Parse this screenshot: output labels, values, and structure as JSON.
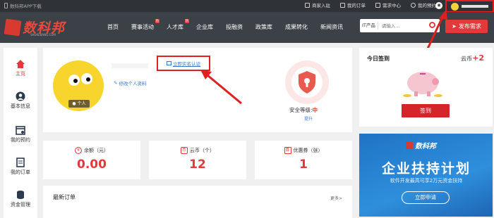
{
  "topbar": {
    "app_download": "数科邦APP下载",
    "links": [
      "商家入驻",
      "我的订单",
      "需求中心",
      "我的预约"
    ]
  },
  "nav": {
    "logo_text": "数科邦",
    "logo_sub": "SHUKEBANG.COM",
    "menu": [
      {
        "label": "首页",
        "hot": ""
      },
      {
        "label": "赛事活动",
        "hot": "热"
      },
      {
        "label": "人才库",
        "hot": "热"
      },
      {
        "label": "企业库",
        "hot": ""
      },
      {
        "label": "投融资",
        "hot": ""
      },
      {
        "label": "政策库",
        "hot": ""
      },
      {
        "label": "成果转化",
        "hot": ""
      },
      {
        "label": "新闻资讯",
        "hot": ""
      }
    ],
    "search_select": "IT产品",
    "search_placeholder": "请输入...",
    "publish_label": "发布需求"
  },
  "sidebar": {
    "items": [
      {
        "label": "主页",
        "icon": "home-icon"
      },
      {
        "label": "基本信息",
        "icon": "user-icon"
      },
      {
        "label": "我的预约",
        "icon": "calendar-icon"
      },
      {
        "label": "我的订单",
        "icon": "order-icon"
      },
      {
        "label": "资金管理",
        "icon": "coins-icon"
      }
    ]
  },
  "profile": {
    "avatar_badge": "个人",
    "verify_label": "立即实名认证",
    "edit_label": "修改个人资料",
    "security_label": "安全等级:",
    "security_level": "中",
    "upgrade_label": "提升"
  },
  "stats": [
    {
      "label": "余额（元）",
      "value": "0.00",
      "icon": "¥"
    },
    {
      "label": "云币（个）",
      "value": "12",
      "icon": "币"
    },
    {
      "label": "优惠券（张）",
      "value": "1",
      "icon": "券"
    }
  ],
  "orders": {
    "title": "最新订单",
    "more": "更多>"
  },
  "signin": {
    "title": "今日签到",
    "coin_label": "云币",
    "coin_value": "+2",
    "button": "签到"
  },
  "ad": {
    "logo": "数科邦",
    "headline": "企业扶持计划",
    "subline": "软件开发最高可享2万元资金扶持",
    "button": "立即申请"
  },
  "colors": {
    "brand_red": "#e23a3a",
    "link_blue": "#3a78c9",
    "nav_dark": "#3c4148"
  }
}
